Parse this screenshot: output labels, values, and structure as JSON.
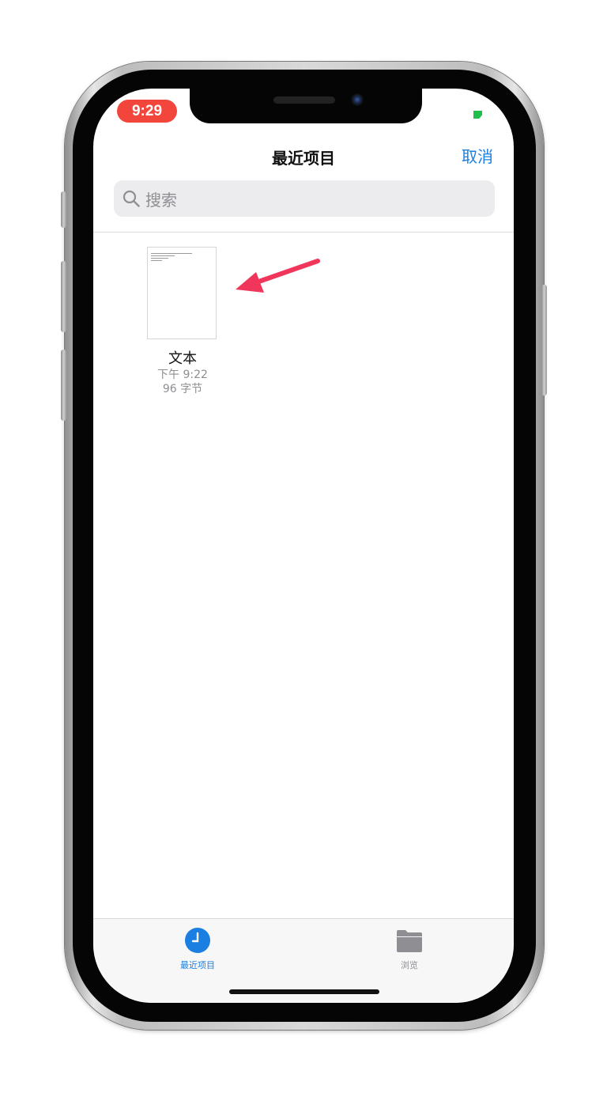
{
  "status_bar": {
    "time": "9:29"
  },
  "header": {
    "title": "最近项目",
    "cancel_label": "取消"
  },
  "search": {
    "placeholder": "搜索"
  },
  "files": [
    {
      "name": "文本",
      "modified": "下午 9:22",
      "size": "96 字节"
    }
  ],
  "tab_bar": {
    "tabs": [
      {
        "label": "最近项目",
        "icon": "clock-icon",
        "selected": true
      },
      {
        "label": "浏览",
        "icon": "folder-icon",
        "selected": false
      }
    ]
  },
  "colors": {
    "accent": "#1a7fe0",
    "status_time_bg": "#f2453b",
    "annotation_arrow": "#f0365a",
    "battery": "#1fbf4b"
  }
}
